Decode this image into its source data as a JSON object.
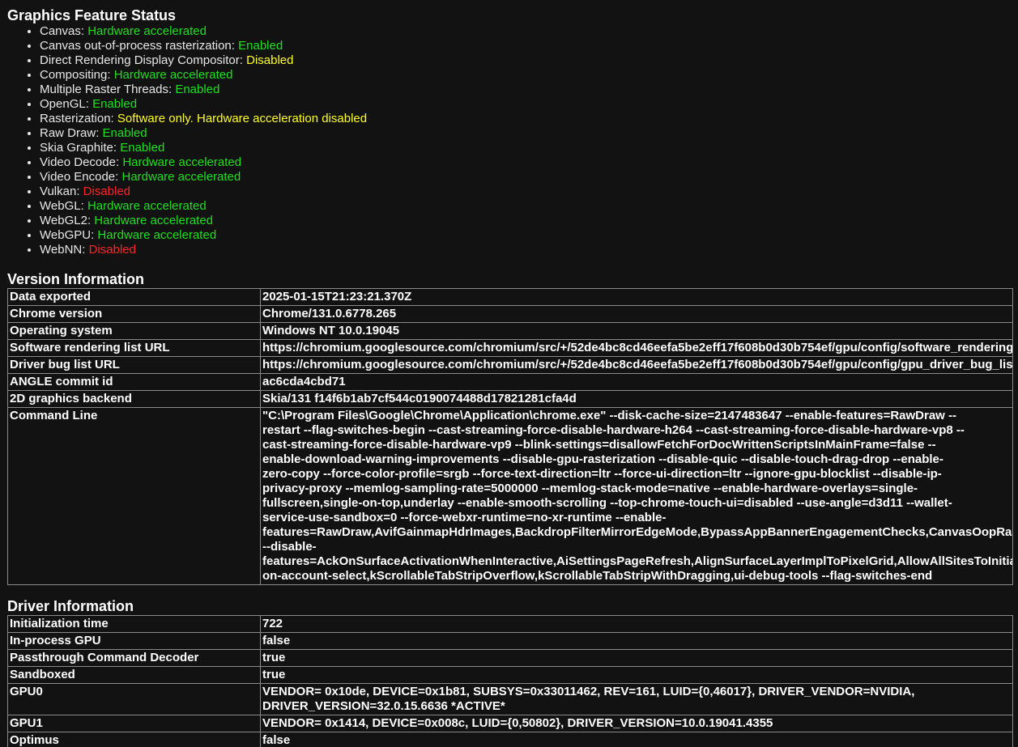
{
  "graphics_feature_status": {
    "title": "Graphics Feature Status",
    "features": [
      {
        "name": "Canvas",
        "status": "Hardware accelerated",
        "state": "ok"
      },
      {
        "name": "Canvas out-of-process rasterization",
        "status": "Enabled",
        "state": "ok"
      },
      {
        "name": "Direct Rendering Display Compositor",
        "status": "Disabled",
        "state": "warn"
      },
      {
        "name": "Compositing",
        "status": "Hardware accelerated",
        "state": "ok"
      },
      {
        "name": "Multiple Raster Threads",
        "status": "Enabled",
        "state": "ok"
      },
      {
        "name": "OpenGL",
        "status": "Enabled",
        "state": "ok"
      },
      {
        "name": "Rasterization",
        "status": "Software only. Hardware acceleration disabled",
        "state": "warn"
      },
      {
        "name": "Raw Draw",
        "status": "Enabled",
        "state": "ok"
      },
      {
        "name": "Skia Graphite",
        "status": "Enabled",
        "state": "ok"
      },
      {
        "name": "Video Decode",
        "status": "Hardware accelerated",
        "state": "ok"
      },
      {
        "name": "Video Encode",
        "status": "Hardware accelerated",
        "state": "ok"
      },
      {
        "name": "Vulkan",
        "status": "Disabled",
        "state": "bad"
      },
      {
        "name": "WebGL",
        "status": "Hardware accelerated",
        "state": "ok"
      },
      {
        "name": "WebGL2",
        "status": "Hardware accelerated",
        "state": "ok"
      },
      {
        "name": "WebGPU",
        "status": "Hardware accelerated",
        "state": "ok"
      },
      {
        "name": "WebNN",
        "status": "Disabled",
        "state": "bad"
      }
    ]
  },
  "version_information": {
    "title": "Version Information",
    "rows": [
      {
        "key": "Data exported",
        "value": "2025-01-15T21:23:21.370Z"
      },
      {
        "key": "Chrome version",
        "value": "Chrome/131.0.6778.265"
      },
      {
        "key": "Operating system",
        "value": "Windows NT 10.0.19045"
      },
      {
        "key": "Software rendering list URL",
        "value": "https://chromium.googlesource.com/chromium/src/+/52de4bc8cd46eefa5be2eff17f608b0d30b754ef/gpu/config/software_rendering_list.json"
      },
      {
        "key": "Driver bug list URL",
        "value": "https://chromium.googlesource.com/chromium/src/+/52de4bc8cd46eefa5be2eff17f608b0d30b754ef/gpu/config/gpu_driver_bug_list.json"
      },
      {
        "key": "ANGLE commit id",
        "value": "ac6cda4cbd71"
      },
      {
        "key": "2D graphics backend",
        "value": "Skia/131 f14f6b1ab7cf544c0190074488d17821281cfa4d"
      }
    ],
    "command_line": {
      "key": "Command Line",
      "lines": [
        "\"C:\\Program Files\\Google\\Chrome\\Application\\chrome.exe\" --disk-cache-size=2147483647 --enable-features=RawDraw --",
        "restart --flag-switches-begin --cast-streaming-force-disable-hardware-h264 --cast-streaming-force-disable-hardware-vp8 --",
        "cast-streaming-force-disable-hardware-vp9 --blink-settings=disallowFetchForDocWrittenScriptsInMainFrame=false --",
        "enable-download-warning-improvements --disable-gpu-rasterization --disable-quic --disable-touch-drag-drop --enable-",
        "zero-copy --force-color-profile=srgb --force-text-direction=ltr --force-ui-direction=ltr --ignore-gpu-blocklist --disable-ip-",
        "privacy-proxy --memlog-sampling-rate=5000000 --memlog-stack-mode=native --enable-hardware-overlays=single-",
        "fullscreen,single-on-top,underlay --enable-smooth-scrolling --top-chrome-touch-ui=disabled --use-angle=d3d11 --wallet-",
        "service-use-sandbox=0 --force-webxr-runtime=no-xr-runtime --enable-",
        "features=RawDraw,AvifGainmapHdrImages,BackdropFilterMirrorEdgeMode,BypassAppBannerEngagementChecks,CanvasOopRasterization",
        "--disable-",
        "features=AckOnSurfaceActivationWhenInteractive,AiSettingsPageRefresh,AlignSurfaceLayerImplToPixelGrid,AllowAllSitesToInitiateMirroring",
        "on-account-select,kScrollableTabStripOverflow,kScrollableTabStripWithDragging,ui-debug-tools --flag-switches-end"
      ]
    }
  },
  "driver_information": {
    "title": "Driver Information",
    "rows": [
      {
        "key": "Initialization time",
        "value": "722"
      },
      {
        "key": "In-process GPU",
        "value": "false"
      },
      {
        "key": "Passthrough Command Decoder",
        "value": "true"
      },
      {
        "key": "Sandboxed",
        "value": "true"
      },
      {
        "key": "GPU0",
        "value": "VENDOR= 0x10de, DEVICE=0x1b81, SUBSYS=0x33011462, REV=161, LUID={0,46017}, DRIVER_VENDOR=NVIDIA, DRIVER_VERSION=32.0.15.6636 *ACTIVE*"
      },
      {
        "key": "GPU1",
        "value": "VENDOR= 0x1414, DEVICE=0x008c, LUID={0,50802}, DRIVER_VERSION=10.0.19041.4355"
      },
      {
        "key": "Optimus",
        "value": "false"
      }
    ]
  },
  "colors": {
    "ok": "#1ee01e",
    "warn": "#ffff2a",
    "bad": "#ff2424",
    "background": "#121212"
  }
}
